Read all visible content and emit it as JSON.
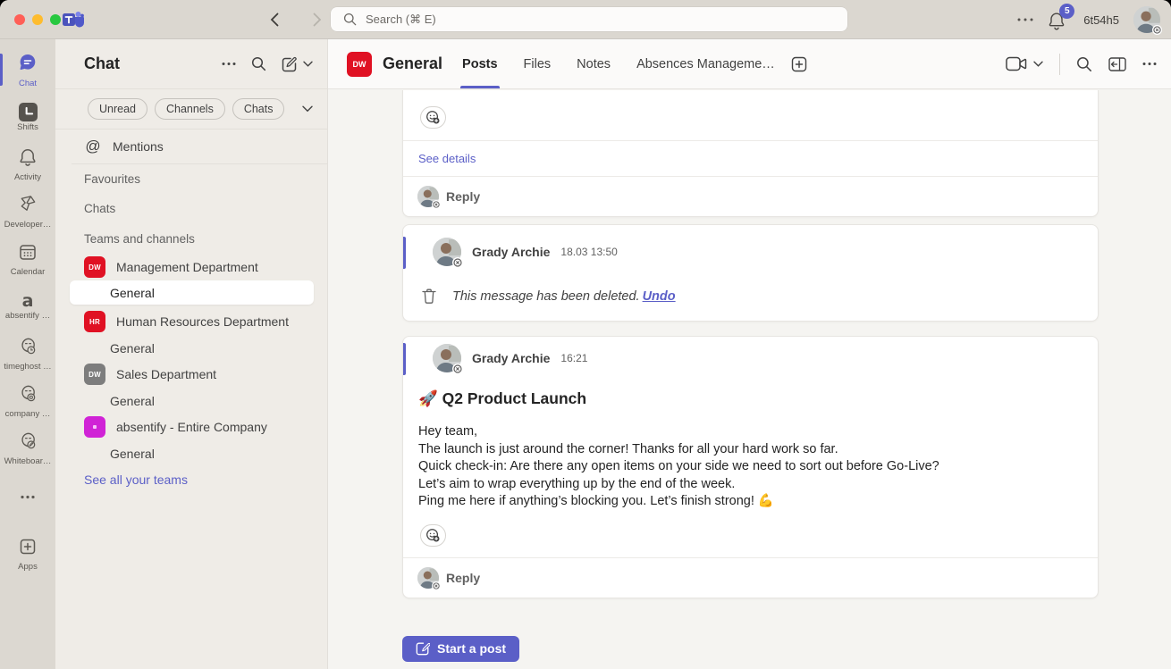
{
  "titlebar": {
    "search_placeholder": "Search (⌘ E)",
    "username": "6t54h5",
    "notification_badge": "5"
  },
  "icons": {
    "mentions_glyph": "@",
    "absentify_rail_glyph": "a"
  },
  "rail": {
    "items": [
      {
        "label": "Chat"
      },
      {
        "label": "Shifts"
      },
      {
        "label": "Activity"
      },
      {
        "label": "Developer…"
      },
      {
        "label": "Calendar"
      },
      {
        "label": "absentify …"
      },
      {
        "label": "timeghost …"
      },
      {
        "label": "company …"
      },
      {
        "label": "Whiteboar…"
      },
      {
        "label": "Apps"
      }
    ]
  },
  "sidebar": {
    "title": "Chat",
    "filters": [
      "Unread",
      "Channels",
      "Chats"
    ],
    "mentions_label": "Mentions",
    "sections": {
      "favourites": "Favourites",
      "chats": "Chats",
      "teams": "Teams and channels"
    },
    "teams": [
      {
        "initials": "DW",
        "name": "Management Department",
        "channel": "General",
        "color": "#e01123"
      },
      {
        "initials": "HR",
        "name": "Human Resources Department",
        "channel": "General",
        "color": "#e01123"
      },
      {
        "initials": "DW",
        "name": "Sales Department",
        "channel": "General",
        "color": "#7d7d7d"
      },
      {
        "initials": "",
        "name": "absentify - Entire Company",
        "channel": "General",
        "color": "#d023d6"
      }
    ],
    "see_all_label": "See all your teams"
  },
  "main": {
    "header": {
      "team_initials": "DW",
      "title": "General",
      "tabs": [
        "Posts",
        "Files",
        "Notes",
        "Absences Manageme…"
      ]
    },
    "thread_top": {
      "see_details_label": "See details",
      "reply_label": "Reply"
    },
    "deleted_message": {
      "author": "Grady Archie",
      "time": "18.03 13:50",
      "text": "This message has been deleted.",
      "undo_label": "Undo"
    },
    "post": {
      "author": "Grady Archie",
      "time": "16:21",
      "title": "🚀 Q2 Product Launch",
      "lines": [
        "Hey team,",
        "The launch is just around the corner! Thanks for all your hard work so far.",
        "Quick check-in: Are there any open items on your side we need to sort out before Go-Live?",
        "Let’s aim to wrap everything up by the end of the week.",
        "Ping me here if anything’s blocking you. Let’s finish strong! 💪"
      ],
      "reply_label": "Reply"
    },
    "composer": {
      "start_post_label": "Start a post"
    }
  },
  "colors": {
    "brand_purple": "#5b5fc7",
    "team_red": "#e01123",
    "team_gray": "#7d7d7d",
    "team_magenta": "#d023d6",
    "titlebar_bg": "#dbd7d0",
    "sidebar_bg": "#efece7",
    "rail_bg": "#dcd8d1",
    "content_bg": "#f5f4f1"
  }
}
